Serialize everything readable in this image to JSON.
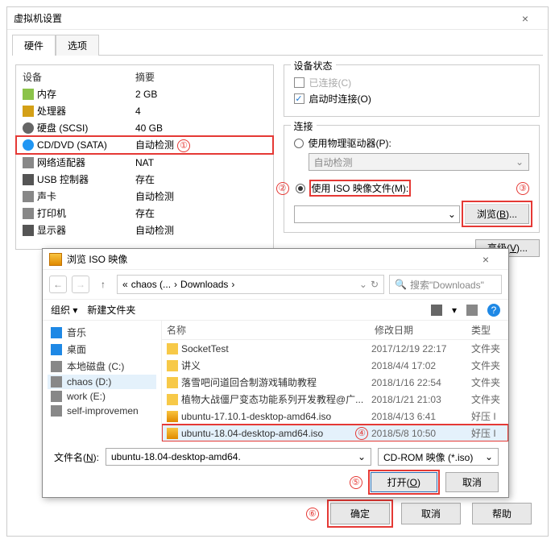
{
  "window": {
    "title": "虚拟机设置"
  },
  "tabs": {
    "hardware": "硬件",
    "options": "选项"
  },
  "deviceHeaders": {
    "device": "设备",
    "summary": "摘要"
  },
  "devices": [
    {
      "name": "内存",
      "summary": "2 GB"
    },
    {
      "name": "处理器",
      "summary": "4"
    },
    {
      "name": "硬盘 (SCSI)",
      "summary": "40 GB"
    },
    {
      "name": "CD/DVD (SATA)",
      "summary": "自动检测"
    },
    {
      "name": "网络适配器",
      "summary": "NAT"
    },
    {
      "name": "USB 控制器",
      "summary": "存在"
    },
    {
      "name": "声卡",
      "summary": "自动检测"
    },
    {
      "name": "打印机",
      "summary": "存在"
    },
    {
      "name": "显示器",
      "summary": "自动检测"
    }
  ],
  "status": {
    "groupTitle": "设备状态",
    "connected": "已连接(C)",
    "connectOnPower": "启动时连接(O)"
  },
  "connection": {
    "groupTitle": "连接",
    "physical": "使用物理驱动器(P):",
    "autoDetect": "自动检测",
    "iso": "使用 ISO 映像文件(M):",
    "browse": "浏览(B)..."
  },
  "advanced": "高级(V)...",
  "badges": {
    "b1": "①",
    "b2": "②",
    "b3": "③",
    "b4": "④",
    "b5": "⑤",
    "b6": "⑥"
  },
  "modal": {
    "title": "浏览 ISO 映像",
    "path1": "chaos (...",
    "path2": "Downloads",
    "searchPlaceholder": "搜索\"Downloads\"",
    "organize": "组织",
    "newFolder": "新建文件夹",
    "side": [
      "音乐",
      "桌面",
      "本地磁盘 (C:)",
      "chaos (D:)",
      "work (E:)",
      "self-improvemen"
    ],
    "columns": {
      "name": "名称",
      "modified": "修改日期",
      "type": "类型"
    },
    "files": [
      {
        "name": "SocketTest",
        "date": "2017/12/19 22:17",
        "type": "文件夹",
        "folder": true
      },
      {
        "name": "讲义",
        "date": "2018/4/4 17:02",
        "type": "文件夹",
        "folder": true
      },
      {
        "name": "落雪吧问道回合制游戏辅助教程",
        "date": "2018/1/16 22:54",
        "type": "文件夹",
        "folder": true
      },
      {
        "name": "植物大战僵尸变态功能系列开发教程@广...",
        "date": "2018/1/21 21:03",
        "type": "文件夹",
        "folder": true
      },
      {
        "name": "ubuntu-17.10.1-desktop-amd64.iso",
        "date": "2018/4/13 6:41",
        "type": "好压 I",
        "folder": false
      },
      {
        "name": "ubuntu-18.04-desktop-amd64.iso",
        "date": "2018/5/8 10:50",
        "type": "好压 I",
        "folder": false
      }
    ],
    "fileNameLabel": "文件名(N):",
    "fileNameValue": "ubuntu-18.04-desktop-amd64.",
    "filter": "CD-ROM 映像 (*.iso)",
    "open": "打开(O)",
    "cancel": "取消"
  },
  "buttons": {
    "ok": "确定",
    "cancel": "取消",
    "help": "帮助"
  }
}
